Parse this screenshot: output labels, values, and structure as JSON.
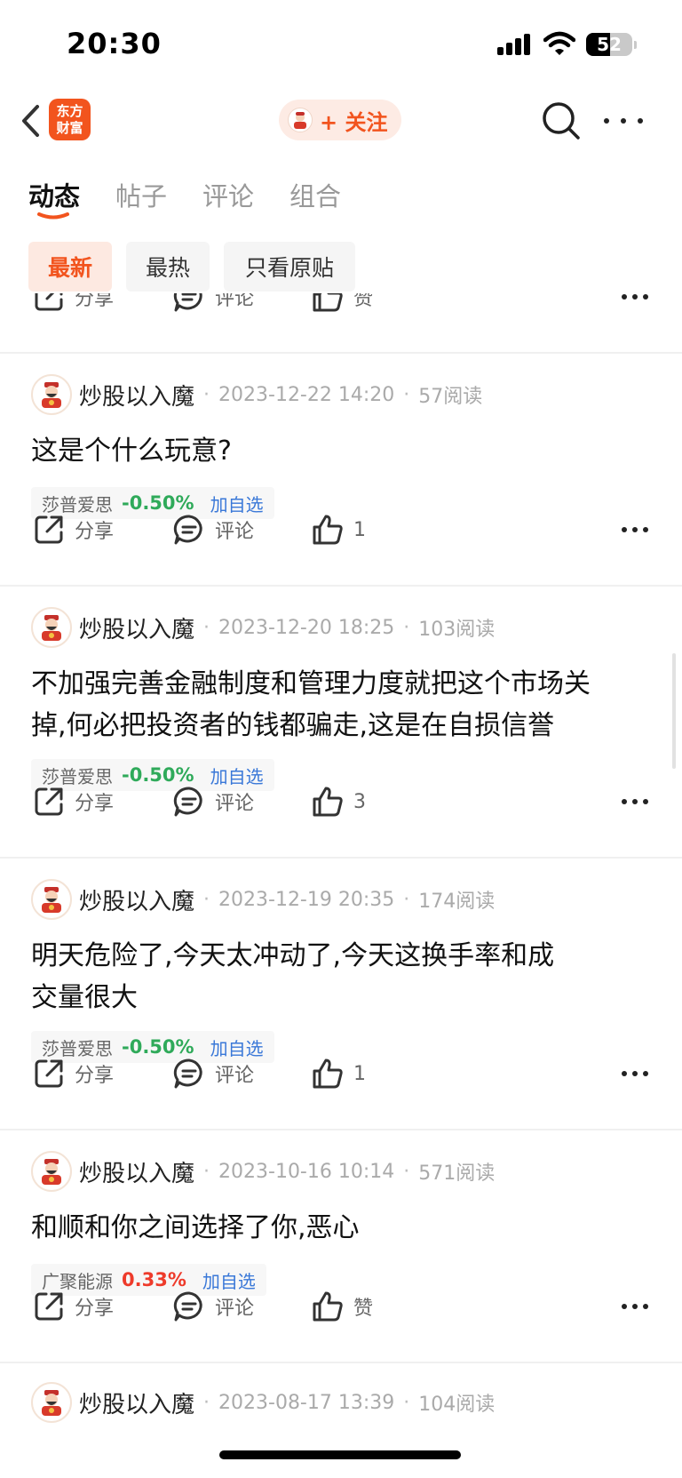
{
  "status_bar": {
    "time": "20:30",
    "battery": "52"
  },
  "nav": {
    "logo_line1": "东方",
    "logo_line2": "财富",
    "follow_label": "+ 关注"
  },
  "tabs": [
    {
      "label": "动态",
      "active": true
    },
    {
      "label": "帖子",
      "active": false
    },
    {
      "label": "评论",
      "active": false
    },
    {
      "label": "组合",
      "active": false
    }
  ],
  "filters": [
    {
      "label": "最新",
      "active": true
    },
    {
      "label": "最热",
      "active": false
    },
    {
      "label": "只看原贴",
      "active": false
    }
  ],
  "colors": {
    "brand": "#f2541e",
    "down": "#2faa5a",
    "up": "#ee3b2b",
    "link": "#3a78d8"
  },
  "top_actions": {
    "share": "分享",
    "comment": "评论",
    "like": "赞"
  },
  "posts": [
    {
      "author": "炒股以入魔",
      "time": "2023-12-22 14:20",
      "reads": "57阅读",
      "lines": [
        "这是个什么玩意?"
      ],
      "stock": {
        "name": "莎普爱思",
        "change": "-0.50%",
        "direction": "down",
        "add": "加自选"
      },
      "share": "分享",
      "comment": "评论",
      "like": "1"
    },
    {
      "author": "炒股以入魔",
      "time": "2023-12-20 18:25",
      "reads": "103阅读",
      "lines": [
        "不加强完善金融制度和管理力度就把这个市场关",
        "掉,何必把投资者的钱都骗走,这是在自损信誉"
      ],
      "stock": {
        "name": "莎普爱思",
        "change": "-0.50%",
        "direction": "down",
        "add": "加自选"
      },
      "share": "分享",
      "comment": "评论",
      "like": "3"
    },
    {
      "author": "炒股以入魔",
      "time": "2023-12-19 20:35",
      "reads": "174阅读",
      "lines": [
        "明天危险了,今天太冲动了,今天这换手率和成",
        "交量很大"
      ],
      "stock": {
        "name": "莎普爱思",
        "change": "-0.50%",
        "direction": "down",
        "add": "加自选"
      },
      "share": "分享",
      "comment": "评论",
      "like": "1"
    },
    {
      "author": "炒股以入魔",
      "time": "2023-10-16 10:14",
      "reads": "571阅读",
      "lines": [
        "和顺和你之间选择了你,恶心"
      ],
      "stock": {
        "name": "广聚能源",
        "change": "0.33%",
        "direction": "up",
        "add": "加自选"
      },
      "share": "分享",
      "comment": "评论",
      "like": "赞"
    },
    {
      "author": "炒股以入魔",
      "time": "2023-08-17 13:39",
      "reads": "104阅读",
      "lines": [],
      "stock": null
    }
  ]
}
